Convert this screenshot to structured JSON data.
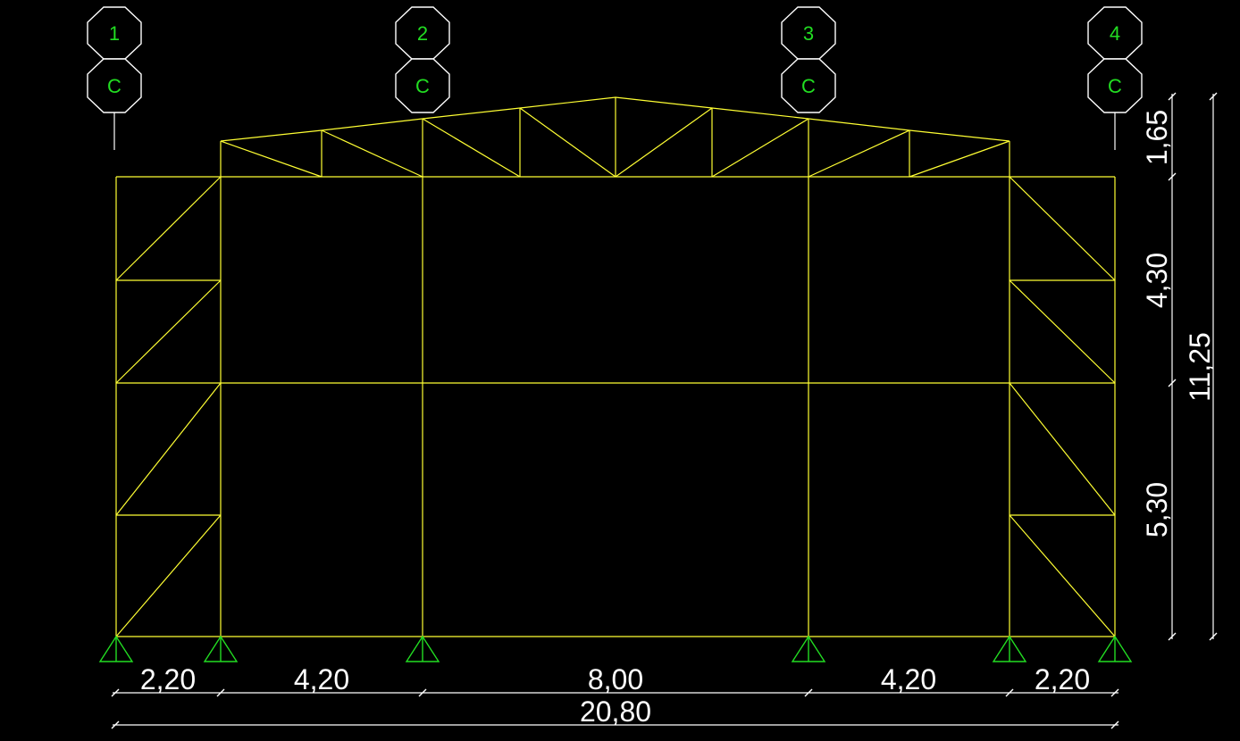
{
  "colors": {
    "background": "#000000",
    "members": "#ffff33",
    "dimensions": "#ffffff",
    "grid_labels": "#22dd22"
  },
  "grid": {
    "axes": [
      {
        "number": "1",
        "letter": "C"
      },
      {
        "number": "2",
        "letter": "C"
      },
      {
        "number": "3",
        "letter": "C"
      },
      {
        "number": "4",
        "letter": "C"
      }
    ]
  },
  "dimensions": {
    "spans": [
      "2,20",
      "4,20",
      "8,00",
      "4,20",
      "2,20"
    ],
    "total_width": "20,80",
    "heights": [
      "5,30",
      "4,30",
      "1,65"
    ],
    "total_height": "11,25"
  },
  "icons": {
    "support": "pin-support-icon",
    "grid_bubble": "octagon-grid-bubble-icon"
  }
}
